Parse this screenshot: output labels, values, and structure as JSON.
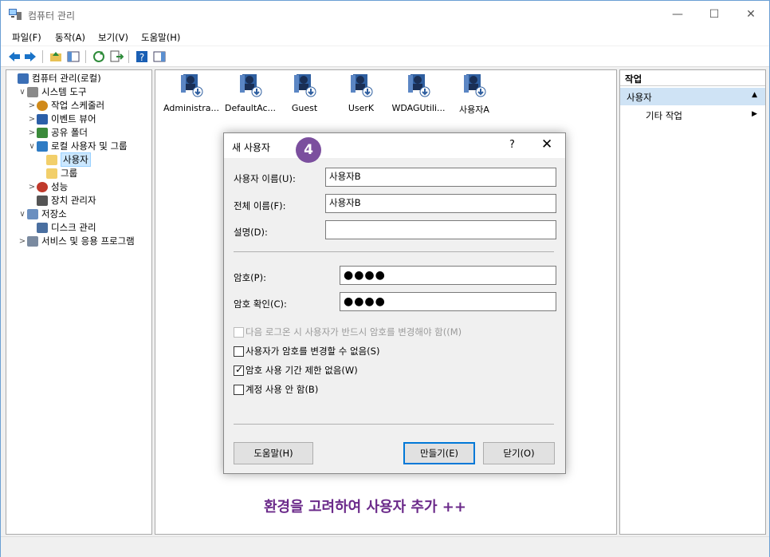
{
  "window": {
    "title": "컴퓨터 관리"
  },
  "menu": [
    "파일(F)",
    "동작(A)",
    "보기(V)",
    "도움말(H)"
  ],
  "tree": [
    {
      "label": "컴퓨터 관리(로컬)",
      "level": 0,
      "exp": ""
    },
    {
      "label": "시스템 도구",
      "level": 1,
      "exp": "∨"
    },
    {
      "label": "작업 스케줄러",
      "level": 2,
      "exp": ">"
    },
    {
      "label": "이벤트 뷰어",
      "level": 2,
      "exp": ">"
    },
    {
      "label": "공유 폴더",
      "level": 2,
      "exp": ">"
    },
    {
      "label": "로컬 사용자 및 그룹",
      "level": 2,
      "exp": "∨"
    },
    {
      "label": "사용자",
      "level": 3,
      "exp": "",
      "selected": true
    },
    {
      "label": "그룹",
      "level": 3,
      "exp": ""
    },
    {
      "label": "성능",
      "level": 2,
      "exp": ">"
    },
    {
      "label": "장치 관리자",
      "level": 2,
      "exp": ""
    },
    {
      "label": "저장소",
      "level": 1,
      "exp": "∨"
    },
    {
      "label": "디스크 관리",
      "level": 2,
      "exp": ""
    },
    {
      "label": "서비스 및 응용 프로그램",
      "level": 1,
      "exp": ">"
    }
  ],
  "users": [
    "Administra...",
    "DefaultAc...",
    "Guest",
    "UserK",
    "WDAGUtili...",
    "사용자A"
  ],
  "actions": {
    "header": "작업",
    "section": "사용자",
    "section_arrow": "▲",
    "item": "기타 작업",
    "item_arrow": "▶"
  },
  "dialog": {
    "title": "새 사용자",
    "help": "?",
    "close": "✕",
    "badge": "4",
    "username_label": "사용자 이름(U):",
    "username_value": "사용자B",
    "fullname_label": "전체 이름(F):",
    "fullname_value": "사용자B",
    "desc_label": "설명(D):",
    "desc_value": "",
    "password_label": "암호(P):",
    "password_value": "●●●●",
    "confirm_label": "암호 확인(C):",
    "confirm_value": "●●●●",
    "chk_change_next": "다음 로그온 시 사용자가 반드시 암호를 변경해야 함((M)",
    "chk_cannot_change": "사용자가 암호를 변경할 수 없음(S)",
    "chk_never_expires": "암호 사용 기간 제한 없음(W)",
    "chk_disabled": "계정 사용 안 함(B)",
    "help_button": "도움말(H)",
    "create_button": "만들기(E)",
    "close_button": "닫기(O)"
  },
  "caption": "환경을 고려하여 사용자 추가 ++"
}
